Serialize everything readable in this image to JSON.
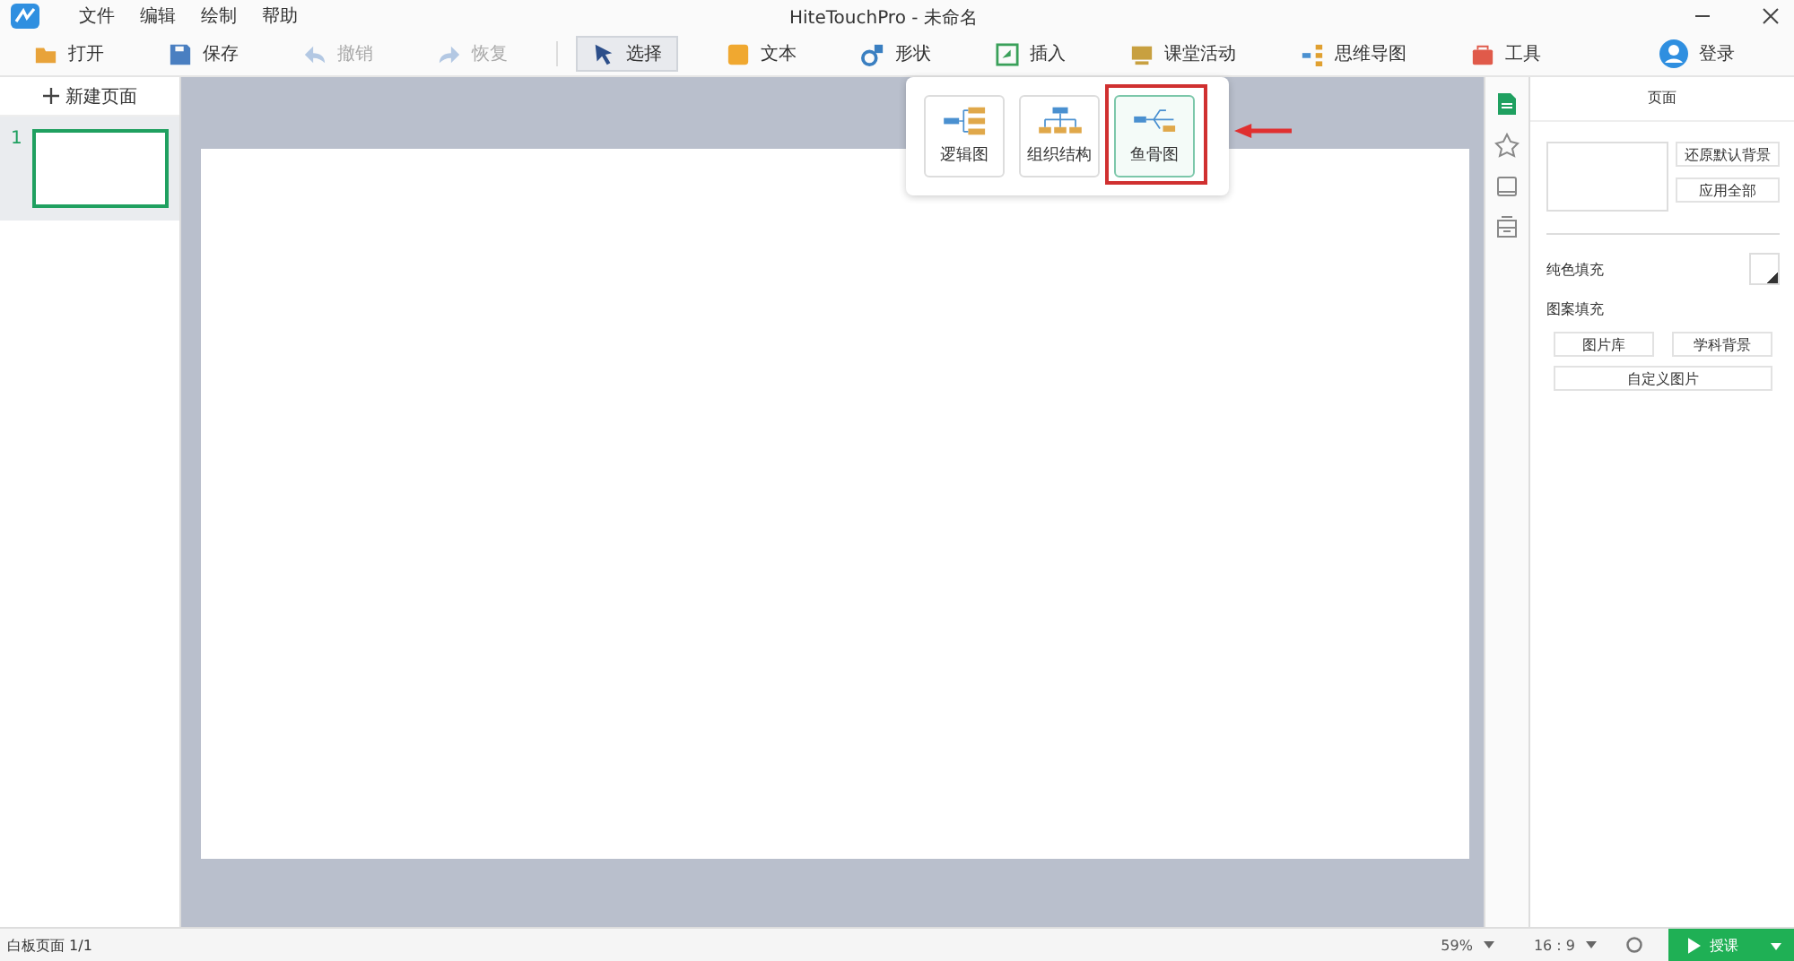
{
  "menu": [
    "文件",
    "编辑",
    "绘制",
    "帮助"
  ],
  "window": {
    "title": "HiteTouchPro - 未命名"
  },
  "toolbar": [
    {
      "kind": "open",
      "label": "打开",
      "disabled": false,
      "selected": false
    },
    {
      "kind": "save",
      "label": "保存",
      "disabled": false,
      "selected": false
    },
    {
      "kind": "undo",
      "label": "撤销",
      "disabled": true,
      "selected": false
    },
    {
      "kind": "redo",
      "label": "恢复",
      "disabled": true,
      "selected": false
    },
    {
      "kind": "select",
      "label": "选择",
      "disabled": false,
      "selected": true
    },
    {
      "kind": "text",
      "label": "文本",
      "disabled": false,
      "selected": false
    },
    {
      "kind": "shape",
      "label": "形状",
      "disabled": false,
      "selected": false
    },
    {
      "kind": "insert",
      "label": "插入",
      "disabled": false,
      "selected": false
    },
    {
      "kind": "class",
      "label": "课堂活动",
      "disabled": false,
      "selected": false
    },
    {
      "kind": "mindmap",
      "label": "思维导图",
      "disabled": false,
      "selected": false
    },
    {
      "kind": "tools",
      "label": "工具",
      "disabled": false,
      "selected": false
    }
  ],
  "login": "登录",
  "pages_panel": {
    "new_page": "新建页面",
    "pages": [
      {
        "number": "1",
        "selected": true
      }
    ]
  },
  "mindmap_popup": [
    {
      "kind": "logic",
      "label": "逻辑图",
      "selected": false,
      "highlighted": false
    },
    {
      "kind": "org",
      "label": "组织结构",
      "selected": false,
      "highlighted": false
    },
    {
      "kind": "fishbone",
      "label": "鱼骨图",
      "selected": true,
      "highlighted": true
    }
  ],
  "side_tabs": [
    {
      "kind": "page",
      "selected": true
    },
    {
      "kind": "effect",
      "selected": false
    },
    {
      "kind": "layer",
      "selected": false
    },
    {
      "kind": "box",
      "selected": false
    }
  ],
  "right_panel": {
    "title": "页面",
    "restore": "还原默认背景",
    "apply_all": "应用全部",
    "solid_fill": "纯色填充",
    "pattern_fill": "图案填充",
    "gallery": "图片库",
    "subject": "学科背景",
    "custom": "自定义图片"
  },
  "status_bar": {
    "page": "白板页面 1/1",
    "zoom": "59%",
    "ratio": "16 : 9",
    "teach": "授课"
  }
}
